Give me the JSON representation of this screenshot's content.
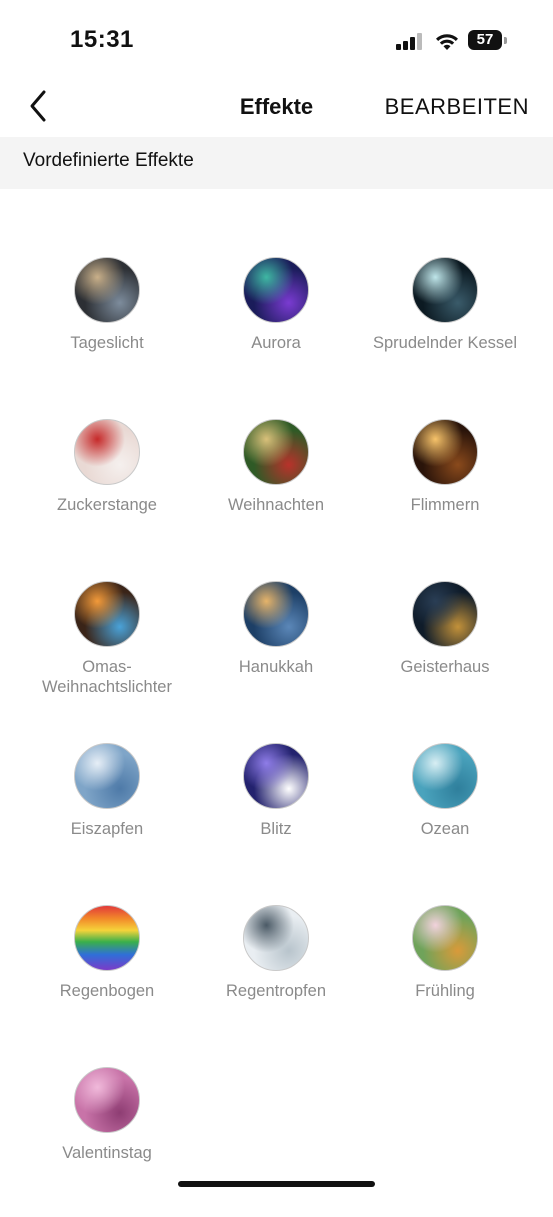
{
  "status": {
    "time": "15:31",
    "battery": "57"
  },
  "nav": {
    "title": "Effekte",
    "edit_label": "BEARBEITEN"
  },
  "section": {
    "title": "Vordefinierte Effekte"
  },
  "effects": [
    {
      "label": "Tageslicht",
      "icon": "tageslicht-icon",
      "colors": [
        "#2c2f34",
        "#c9b08a",
        "#7d8c9c"
      ]
    },
    {
      "label": "Aurora",
      "icon": "aurora-icon",
      "colors": [
        "#1a1c5a",
        "#3fb7a3",
        "#7a3bd1"
      ]
    },
    {
      "label": "Sprudelnder Kessel",
      "icon": "kessel-icon",
      "colors": [
        "#0c1a22",
        "#bfe6ea",
        "#3a5b6a"
      ]
    },
    {
      "label": "Zuckerstange",
      "icon": "zuckerstange-icon",
      "colors": [
        "#e9d9d4",
        "#c62a2a",
        "#f5f0ee"
      ]
    },
    {
      "label": "Weihnachten",
      "icon": "weihnachten-icon",
      "colors": [
        "#2f5a26",
        "#d9c07a",
        "#b8322b"
      ]
    },
    {
      "label": "Flimmern",
      "icon": "flimmern-icon",
      "colors": [
        "#2a140a",
        "#f7c36a",
        "#8a4a1c"
      ]
    },
    {
      "label": "Omas-Weihnachtslichter",
      "icon": "lichter-icon",
      "colors": [
        "#3a2418",
        "#f29a3a",
        "#4aa2d8"
      ]
    },
    {
      "label": "Hanukkah",
      "icon": "hanukkah-icon",
      "colors": [
        "#1d3f66",
        "#e6b46a",
        "#5b87b8"
      ]
    },
    {
      "label": "Geisterhaus",
      "icon": "geisterhaus-icon",
      "colors": [
        "#0f1c2a",
        "#2a3e55",
        "#c2913a"
      ]
    },
    {
      "label": "Eiszapfen",
      "icon": "eiszapfen-icon",
      "colors": [
        "#7fa5c8",
        "#e6eef6",
        "#4e7aa8"
      ]
    },
    {
      "label": "Blitz",
      "icon": "blitz-icon",
      "colors": [
        "#23226e",
        "#8f7de8",
        "#ffffff"
      ]
    },
    {
      "label": "Ozean",
      "icon": "ozean-icon",
      "colors": [
        "#4aa3bd",
        "#d8eef3",
        "#2f7f9c"
      ]
    },
    {
      "label": "Regenbogen",
      "icon": "regenbogen-icon",
      "colors": [
        "#e23a3a",
        "#f5d33a",
        "#3ab04a"
      ]
    },
    {
      "label": "Regentropfen",
      "icon": "regentropfen-icon",
      "colors": [
        "#e9eef2",
        "#4b5a66",
        "#b8c4cc"
      ]
    },
    {
      "label": "Frühling",
      "icon": "fruehling-icon",
      "colors": [
        "#6fa35a",
        "#f2d2dc",
        "#d99a3a"
      ]
    },
    {
      "label": "Valentinstag",
      "icon": "valentinstag-icon",
      "colors": [
        "#c873a8",
        "#f0b9da",
        "#8e3d73"
      ]
    }
  ]
}
